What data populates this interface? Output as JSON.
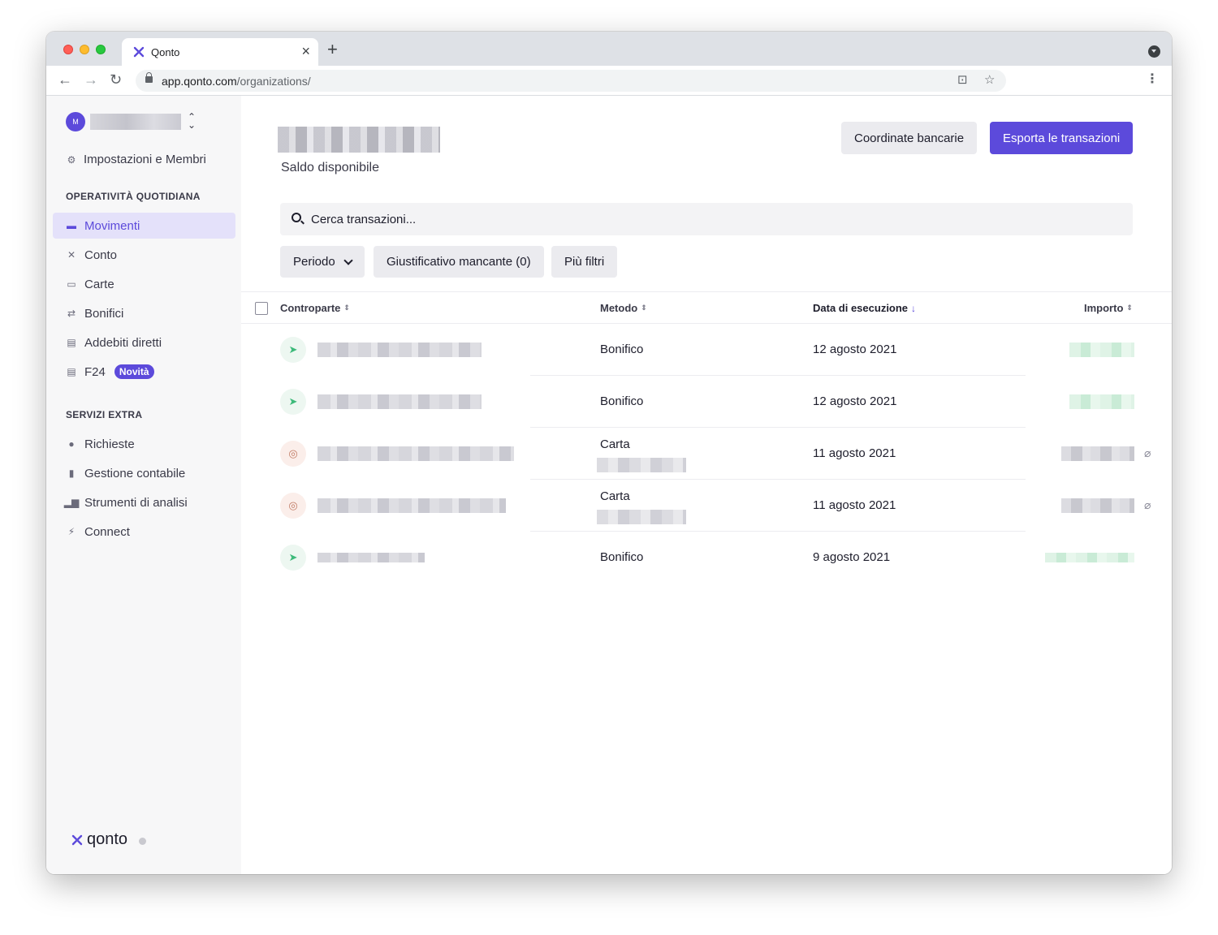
{
  "browser": {
    "tab_title": "Qonto",
    "tab_close": "×",
    "new_tab": "+",
    "back": "←",
    "forward": "→",
    "reload": "↻",
    "url_host": "app.qonto.com",
    "url_path": "/organizations/",
    "translate": "⊡",
    "bookmark": "☆",
    "menu": "⋮"
  },
  "sidebar": {
    "org_initial": "M",
    "org_switch": "⌃⌄",
    "settings_label": "Impostazioni e Membri",
    "section_daily": "OPERATIVITÀ QUOTIDIANA",
    "daily_items": [
      {
        "label": "Movimenti",
        "icon": "wallet-icon"
      },
      {
        "label": "Conto",
        "icon": "qonto-icon"
      },
      {
        "label": "Carte",
        "icon": "card-icon"
      },
      {
        "label": "Bonifici",
        "icon": "transfer-icon"
      },
      {
        "label": "Addebiti diretti",
        "icon": "direct-debit-icon"
      },
      {
        "label": "F24",
        "icon": "f24-icon",
        "badge": "Novità"
      }
    ],
    "section_extra": "SERVIZI EXTRA",
    "extra_items": [
      {
        "label": "Richieste",
        "icon": "request-icon"
      },
      {
        "label": "Gestione contabile",
        "icon": "accounting-icon"
      },
      {
        "label": "Strumenti di analisi",
        "icon": "analytics-icon"
      },
      {
        "label": "Connect",
        "icon": "plug-icon"
      }
    ],
    "brand": "qonto"
  },
  "header": {
    "balance_label": "Saldo disponibile",
    "bank_details_button": "Coordinate bancarie",
    "export_button": "Esporta le transazioni"
  },
  "search": {
    "placeholder": "Cerca transazioni..."
  },
  "filters": {
    "period": "Periodo",
    "missing_receipt": "Giustificativo mancante (0)",
    "more_filters": "Più filtri"
  },
  "table": {
    "columns": {
      "counterparty": "Controparte",
      "method": "Metodo",
      "execution_date": "Data di esecuzione",
      "amount": "Importo"
    },
    "sort_icon": "⇕",
    "sort_down": "↓",
    "rows": [
      {
        "method": "Bonifico",
        "date": "12 agosto 2021",
        "kind": "transfer",
        "amount_color": "green",
        "attachment": false
      },
      {
        "method": "Bonifico",
        "date": "12 agosto 2021",
        "kind": "transfer",
        "amount_color": "green",
        "attachment": false
      },
      {
        "method": "Carta",
        "date": "11 agosto 2021",
        "kind": "card",
        "amount_color": "grey",
        "attachment": true
      },
      {
        "method": "Carta",
        "date": "11 agosto 2021",
        "kind": "card",
        "amount_color": "grey",
        "attachment": true
      },
      {
        "method": "Bonifico",
        "date": "9 agosto 2021",
        "kind": "transfer",
        "amount_color": "green",
        "attachment": false
      }
    ]
  },
  "colors": {
    "accent": "#5c4adb",
    "sidebar_bg": "#f7f7f8",
    "active_bg": "#e4e1fa"
  }
}
